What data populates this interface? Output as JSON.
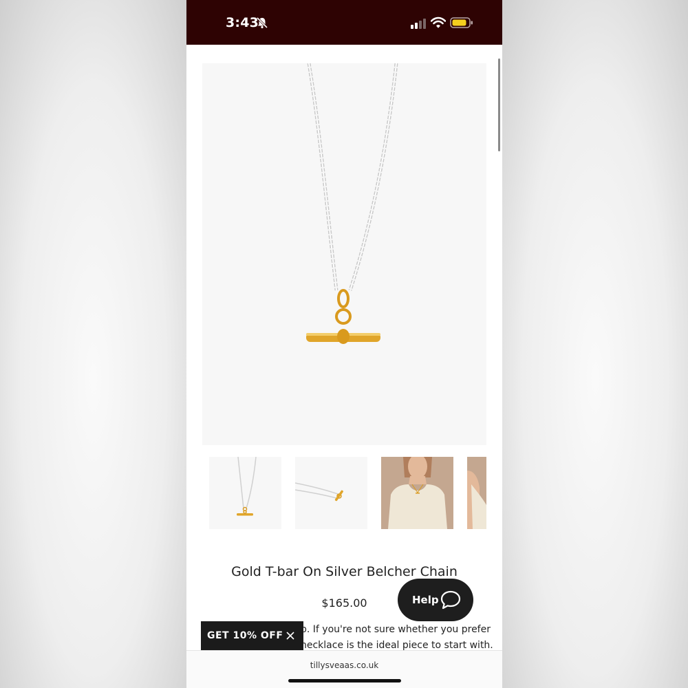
{
  "status_bar": {
    "time": "3:43",
    "background": "#2e0303"
  },
  "product": {
    "title": "Gold T-bar On Silver Belcher Chain",
    "price": "$165.00",
    "description_line_1": "p. If you're not sure whether you prefer",
    "description_line_2": "necklace is the ideal piece to start with.",
    "gallery": [
      {
        "name": "necklace-front",
        "icon": "necklace-image"
      },
      {
        "name": "necklace-side",
        "icon": "necklace-image"
      },
      {
        "name": "model-wearing-necklace",
        "icon": "model-image"
      },
      {
        "name": "model-partial",
        "icon": "model-image"
      }
    ],
    "colors": {
      "gold": "#e0a52a",
      "silver": "#d9d9d9",
      "image_bg": "#f7f7f7"
    }
  },
  "help_widget": {
    "label": "Help",
    "icon": "chat-bubble-icon",
    "background": "#1e1e1e"
  },
  "discount_banner": {
    "label": "GET 10% OFF",
    "close_icon": "close-icon"
  },
  "browser": {
    "url": "tillysveaas.co.uk"
  }
}
